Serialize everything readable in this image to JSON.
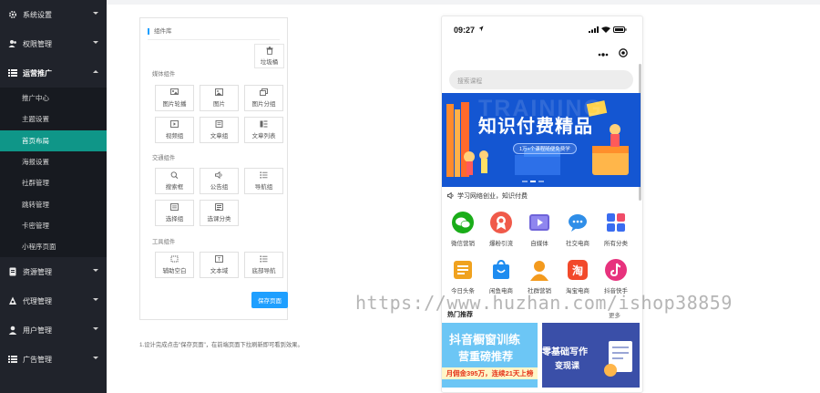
{
  "sidebar": {
    "menus": [
      {
        "label": "系统设置",
        "icon": "gear-icon",
        "expanded": false
      },
      {
        "label": "权限管理",
        "icon": "users-icon",
        "expanded": false
      },
      {
        "label": "运营推广",
        "icon": "list-icon",
        "expanded": true
      },
      {
        "label": "资源管理",
        "icon": "file-icon",
        "expanded": false
      },
      {
        "label": "代理管理",
        "icon": "badge-icon",
        "expanded": false
      },
      {
        "label": "用户管理",
        "icon": "user-icon",
        "expanded": false
      },
      {
        "label": "广告管理",
        "icon": "list-icon",
        "expanded": false
      }
    ],
    "submenu": [
      {
        "label": "推广中心",
        "active": false
      },
      {
        "label": "主题设置",
        "active": false
      },
      {
        "label": "首页布局",
        "active": true
      },
      {
        "label": "海报设置",
        "active": false
      },
      {
        "label": "社群管理",
        "active": false
      },
      {
        "label": "跳转管理",
        "active": false
      },
      {
        "label": "卡密管理",
        "active": false
      },
      {
        "label": "小程序页面",
        "active": false
      }
    ]
  },
  "library": {
    "title": "组件库",
    "recycle_label": "垃圾桶",
    "sections": [
      {
        "label": "媒体组件",
        "items": [
          "图片轮播",
          "图片",
          "图片分组",
          "视频组",
          "文章组",
          "文章列表"
        ]
      },
      {
        "label": "交通组件",
        "items": [
          "搜索框",
          "公告组",
          "导航组",
          "选择组",
          "选课分类"
        ]
      },
      {
        "label": "工具组件",
        "items": [
          "辅助空白",
          "文本域",
          "底部导航"
        ]
      }
    ],
    "save_label": "保存页面",
    "note": "1.设计完成点击\"保存页面\"，在前端页面下拉刷新即可看到效果。"
  },
  "phone": {
    "time": "09:27",
    "search_placeholder": "搜索课程",
    "banner": {
      "watermark": "TRAINING",
      "title": "知识付费精品",
      "subtitle": "1万+个课程随便免费学"
    },
    "notice": "学习网络创业，知识付费",
    "icons": [
      {
        "label": "微信营销",
        "color": "#1aad19"
      },
      {
        "label": "爆粉引流",
        "color": "#f05a4a"
      },
      {
        "label": "自媒体",
        "color": "#6e63d9"
      },
      {
        "label": "社交电商",
        "color": "#2f8ee8"
      },
      {
        "label": "所有分类",
        "color": "#3a6cf0"
      },
      {
        "label": "今日头条",
        "color": "#f0a21f"
      },
      {
        "label": "闲鱼电商",
        "color": "#1e8cf0"
      },
      {
        "label": "社群营销",
        "color": "#f39a1e"
      },
      {
        "label": "淘宝电商",
        "color": "#f2492a"
      },
      {
        "label": "抖音快手",
        "color": "#e7327d"
      }
    ],
    "section_title": "热门推荐",
    "section_more": "更多",
    "card1": {
      "line1": "抖音橱窗训练",
      "line2": "营重磅推荐",
      "line3": "月佣金395万，连续21天上榜"
    },
    "card2": {
      "line1": "零基础写作",
      "line2": "变现课"
    }
  },
  "watermark": "https://www.huzhan.com/ishop38859"
}
